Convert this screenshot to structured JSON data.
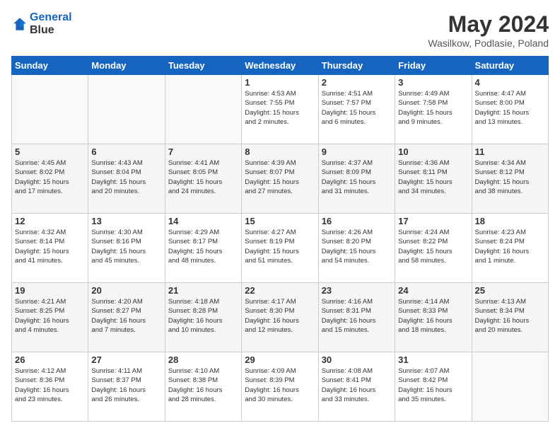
{
  "header": {
    "logo_line1": "General",
    "logo_line2": "Blue",
    "month": "May 2024",
    "location": "Wasilkow, Podlasie, Poland"
  },
  "days_of_week": [
    "Sunday",
    "Monday",
    "Tuesday",
    "Wednesday",
    "Thursday",
    "Friday",
    "Saturday"
  ],
  "weeks": [
    {
      "row_class": "row-light",
      "days": [
        {
          "num": "",
          "lines": [],
          "empty": true
        },
        {
          "num": "",
          "lines": [],
          "empty": true
        },
        {
          "num": "",
          "lines": [],
          "empty": true
        },
        {
          "num": "1",
          "lines": [
            "Sunrise: 4:53 AM",
            "Sunset: 7:55 PM",
            "Daylight: 15 hours",
            "and 2 minutes."
          ],
          "empty": false
        },
        {
          "num": "2",
          "lines": [
            "Sunrise: 4:51 AM",
            "Sunset: 7:57 PM",
            "Daylight: 15 hours",
            "and 6 minutes."
          ],
          "empty": false
        },
        {
          "num": "3",
          "lines": [
            "Sunrise: 4:49 AM",
            "Sunset: 7:58 PM",
            "Daylight: 15 hours",
            "and 9 minutes."
          ],
          "empty": false
        },
        {
          "num": "4",
          "lines": [
            "Sunrise: 4:47 AM",
            "Sunset: 8:00 PM",
            "Daylight: 15 hours",
            "and 13 minutes."
          ],
          "empty": false
        }
      ]
    },
    {
      "row_class": "row-dark",
      "days": [
        {
          "num": "5",
          "lines": [
            "Sunrise: 4:45 AM",
            "Sunset: 8:02 PM",
            "Daylight: 15 hours",
            "and 17 minutes."
          ],
          "empty": false
        },
        {
          "num": "6",
          "lines": [
            "Sunrise: 4:43 AM",
            "Sunset: 8:04 PM",
            "Daylight: 15 hours",
            "and 20 minutes."
          ],
          "empty": false
        },
        {
          "num": "7",
          "lines": [
            "Sunrise: 4:41 AM",
            "Sunset: 8:05 PM",
            "Daylight: 15 hours",
            "and 24 minutes."
          ],
          "empty": false
        },
        {
          "num": "8",
          "lines": [
            "Sunrise: 4:39 AM",
            "Sunset: 8:07 PM",
            "Daylight: 15 hours",
            "and 27 minutes."
          ],
          "empty": false
        },
        {
          "num": "9",
          "lines": [
            "Sunrise: 4:37 AM",
            "Sunset: 8:09 PM",
            "Daylight: 15 hours",
            "and 31 minutes."
          ],
          "empty": false
        },
        {
          "num": "10",
          "lines": [
            "Sunrise: 4:36 AM",
            "Sunset: 8:11 PM",
            "Daylight: 15 hours",
            "and 34 minutes."
          ],
          "empty": false
        },
        {
          "num": "11",
          "lines": [
            "Sunrise: 4:34 AM",
            "Sunset: 8:12 PM",
            "Daylight: 15 hours",
            "and 38 minutes."
          ],
          "empty": false
        }
      ]
    },
    {
      "row_class": "row-light",
      "days": [
        {
          "num": "12",
          "lines": [
            "Sunrise: 4:32 AM",
            "Sunset: 8:14 PM",
            "Daylight: 15 hours",
            "and 41 minutes."
          ],
          "empty": false
        },
        {
          "num": "13",
          "lines": [
            "Sunrise: 4:30 AM",
            "Sunset: 8:16 PM",
            "Daylight: 15 hours",
            "and 45 minutes."
          ],
          "empty": false
        },
        {
          "num": "14",
          "lines": [
            "Sunrise: 4:29 AM",
            "Sunset: 8:17 PM",
            "Daylight: 15 hours",
            "and 48 minutes."
          ],
          "empty": false
        },
        {
          "num": "15",
          "lines": [
            "Sunrise: 4:27 AM",
            "Sunset: 8:19 PM",
            "Daylight: 15 hours",
            "and 51 minutes."
          ],
          "empty": false
        },
        {
          "num": "16",
          "lines": [
            "Sunrise: 4:26 AM",
            "Sunset: 8:20 PM",
            "Daylight: 15 hours",
            "and 54 minutes."
          ],
          "empty": false
        },
        {
          "num": "17",
          "lines": [
            "Sunrise: 4:24 AM",
            "Sunset: 8:22 PM",
            "Daylight: 15 hours",
            "and 58 minutes."
          ],
          "empty": false
        },
        {
          "num": "18",
          "lines": [
            "Sunrise: 4:23 AM",
            "Sunset: 8:24 PM",
            "Daylight: 16 hours",
            "and 1 minute."
          ],
          "empty": false
        }
      ]
    },
    {
      "row_class": "row-dark",
      "days": [
        {
          "num": "19",
          "lines": [
            "Sunrise: 4:21 AM",
            "Sunset: 8:25 PM",
            "Daylight: 16 hours",
            "and 4 minutes."
          ],
          "empty": false
        },
        {
          "num": "20",
          "lines": [
            "Sunrise: 4:20 AM",
            "Sunset: 8:27 PM",
            "Daylight: 16 hours",
            "and 7 minutes."
          ],
          "empty": false
        },
        {
          "num": "21",
          "lines": [
            "Sunrise: 4:18 AM",
            "Sunset: 8:28 PM",
            "Daylight: 16 hours",
            "and 10 minutes."
          ],
          "empty": false
        },
        {
          "num": "22",
          "lines": [
            "Sunrise: 4:17 AM",
            "Sunset: 8:30 PM",
            "Daylight: 16 hours",
            "and 12 minutes."
          ],
          "empty": false
        },
        {
          "num": "23",
          "lines": [
            "Sunrise: 4:16 AM",
            "Sunset: 8:31 PM",
            "Daylight: 16 hours",
            "and 15 minutes."
          ],
          "empty": false
        },
        {
          "num": "24",
          "lines": [
            "Sunrise: 4:14 AM",
            "Sunset: 8:33 PM",
            "Daylight: 16 hours",
            "and 18 minutes."
          ],
          "empty": false
        },
        {
          "num": "25",
          "lines": [
            "Sunrise: 4:13 AM",
            "Sunset: 8:34 PM",
            "Daylight: 16 hours",
            "and 20 minutes."
          ],
          "empty": false
        }
      ]
    },
    {
      "row_class": "row-light",
      "days": [
        {
          "num": "26",
          "lines": [
            "Sunrise: 4:12 AM",
            "Sunset: 8:36 PM",
            "Daylight: 16 hours",
            "and 23 minutes."
          ],
          "empty": false
        },
        {
          "num": "27",
          "lines": [
            "Sunrise: 4:11 AM",
            "Sunset: 8:37 PM",
            "Daylight: 16 hours",
            "and 26 minutes."
          ],
          "empty": false
        },
        {
          "num": "28",
          "lines": [
            "Sunrise: 4:10 AM",
            "Sunset: 8:38 PM",
            "Daylight: 16 hours",
            "and 28 minutes."
          ],
          "empty": false
        },
        {
          "num": "29",
          "lines": [
            "Sunrise: 4:09 AM",
            "Sunset: 8:39 PM",
            "Daylight: 16 hours",
            "and 30 minutes."
          ],
          "empty": false
        },
        {
          "num": "30",
          "lines": [
            "Sunrise: 4:08 AM",
            "Sunset: 8:41 PM",
            "Daylight: 16 hours",
            "and 33 minutes."
          ],
          "empty": false
        },
        {
          "num": "31",
          "lines": [
            "Sunrise: 4:07 AM",
            "Sunset: 8:42 PM",
            "Daylight: 16 hours",
            "and 35 minutes."
          ],
          "empty": false
        },
        {
          "num": "",
          "lines": [],
          "empty": true
        }
      ]
    }
  ]
}
